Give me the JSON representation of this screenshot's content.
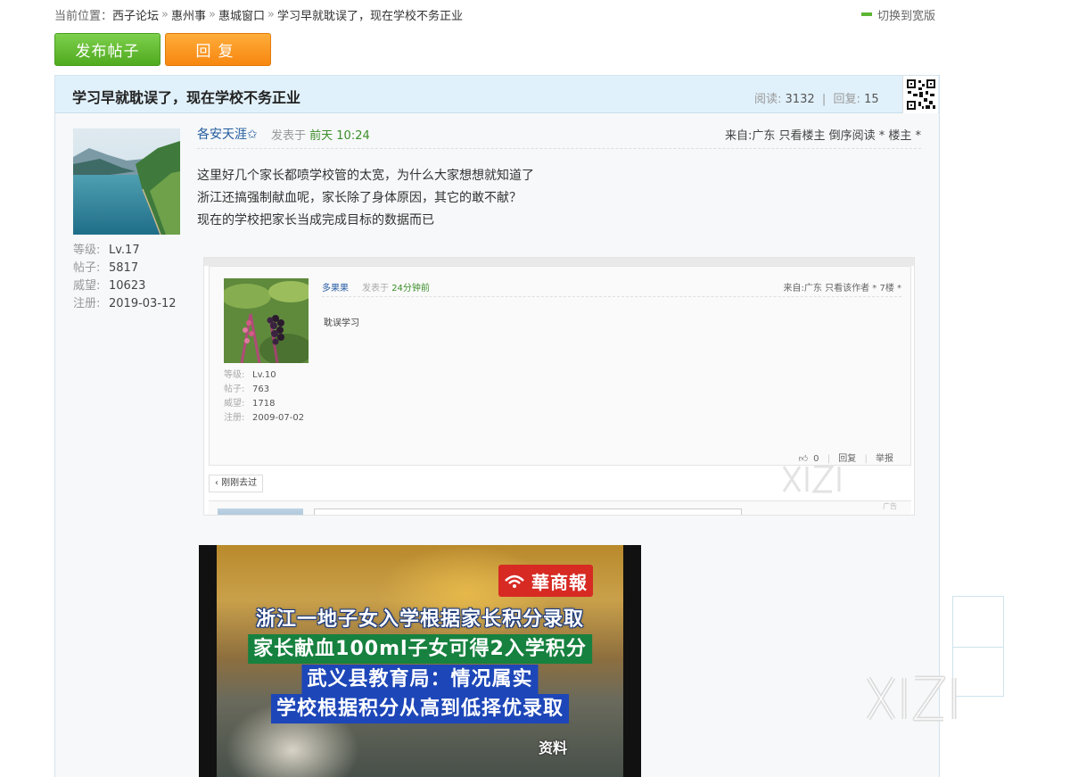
{
  "breadcrumb": {
    "prefix": "当前位置：",
    "items": [
      "西子论坛",
      "惠州事",
      "惠城窗口",
      "学习早就耽误了，现在学校不务正业"
    ],
    "separator": "»"
  },
  "switch_wide_label": "切换到宽版",
  "toolbar": {
    "post_label": "发布帖子",
    "reply_label": "回复"
  },
  "thread": {
    "title": "学习早就耽误了，现在学校不务正业",
    "views_label": "阅读:",
    "views": "3132",
    "divider": "|",
    "replies_label": "回复:",
    "replies": "15"
  },
  "author": {
    "stats": [
      {
        "k": "等级:",
        "v": "Lv.17"
      },
      {
        "k": "帖子:",
        "v": "5817"
      },
      {
        "k": "威望:",
        "v": "10623"
      },
      {
        "k": "注册:",
        "v": "2019-03-12"
      }
    ]
  },
  "post": {
    "author": "各安天涯✩",
    "posted_prefix": "发表于",
    "time": "前天 10:24",
    "right_links": "来自:广东  只看楼主  倒序阅读  * 楼主 *",
    "lines": [
      "这里好几个家长都喷学校管的太宽，为什么大家想想就知道了",
      "浙江还搞强制献血呢，家长除了身体原因，其它的敢不献？",
      "现在的学校把家长当成完成目标的数据而已"
    ]
  },
  "embedded": {
    "author": "多果果",
    "posted_prefix": "发表于",
    "time": "24分钟前",
    "right_links": "来自:广东  只看该作者  * 7楼 *",
    "content": "耽误学习",
    "stats": [
      {
        "k": "等级:",
        "v": "Lv.10"
      },
      {
        "k": "帖子:",
        "v": "763"
      },
      {
        "k": "威望:",
        "v": "1718"
      },
      {
        "k": "注册:",
        "v": "2009-07-02"
      }
    ],
    "likes": "0",
    "reply_link": "回复",
    "report_link": "举报",
    "back_tag": "‹ 刚刚去过",
    "ad_tag": "广告"
  },
  "video": {
    "logo_text": "華商報",
    "captions": [
      "浙江一地子女入学根据家长积分录取",
      "家长献血100ml子女可得2入学积分",
      "武义县教育局：情况属实",
      "学校根据积分从高到低择优录取"
    ],
    "source_label": "资料"
  },
  "colors": {
    "accent_green": "#5cb531",
    "accent_orange": "#f7860f",
    "header_blue": "#e1f1fb",
    "link_blue": "#225b9e"
  }
}
